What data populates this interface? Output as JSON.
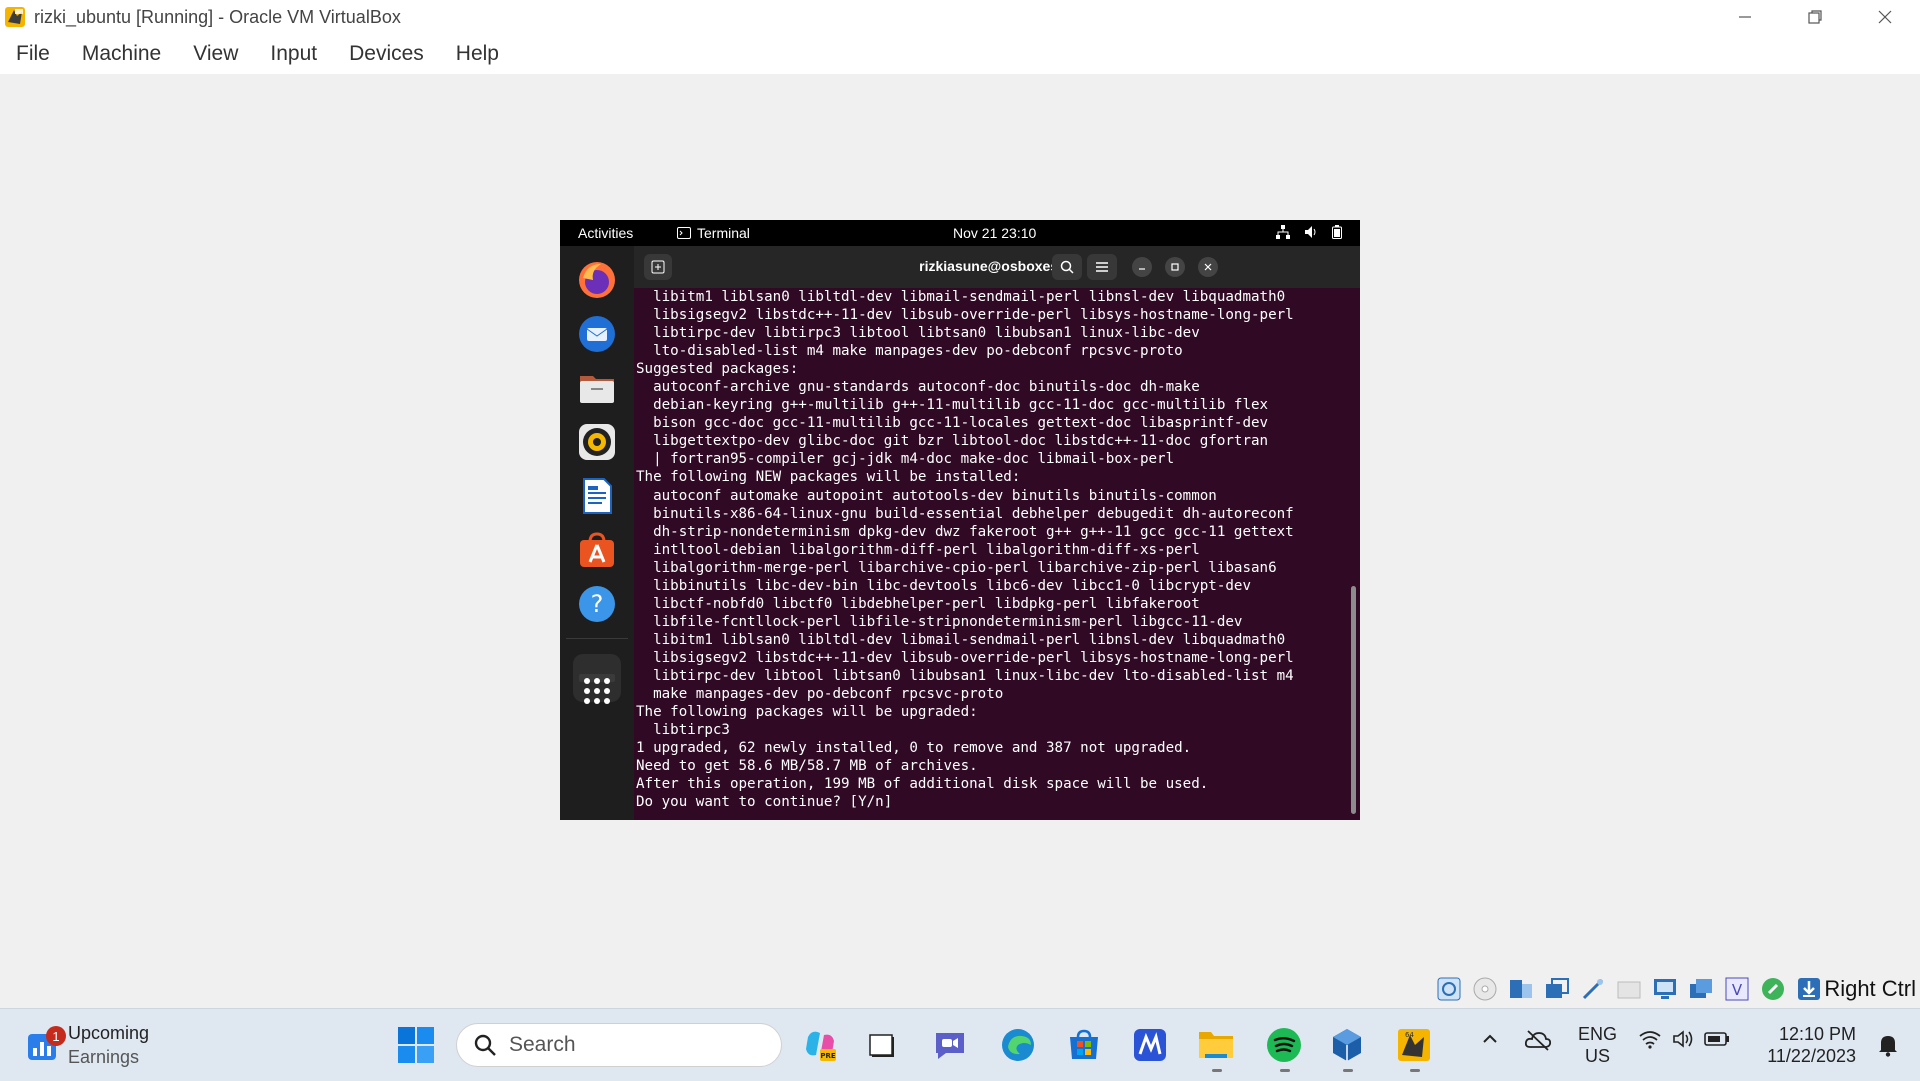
{
  "vbox": {
    "title": "rizki_ubuntu [Running] - Oracle VM VirtualBox",
    "menu": [
      "File",
      "Machine",
      "View",
      "Input",
      "Devices",
      "Help"
    ],
    "host_key": "Right Ctrl"
  },
  "gnome": {
    "activities": "Activities",
    "app_name": "Terminal",
    "clock": "Nov 21  23:10"
  },
  "terminal": {
    "title": "rizkiasune@osboxes: ~",
    "lines": [
      "  libitm1 liblsan0 libltdl-dev libmail-sendmail-perl libnsl-dev libquadmath0",
      "  libsigsegv2 libstdc++-11-dev libsub-override-perl libsys-hostname-long-perl",
      "  libtirpc-dev libtirpc3 libtool libtsan0 libubsan1 linux-libc-dev",
      "  lto-disabled-list m4 make manpages-dev po-debconf rpcsvc-proto",
      "Suggested packages:",
      "  autoconf-archive gnu-standards autoconf-doc binutils-doc dh-make",
      "  debian-keyring g++-multilib g++-11-multilib gcc-11-doc gcc-multilib flex",
      "  bison gcc-doc gcc-11-multilib gcc-11-locales gettext-doc libasprintf-dev",
      "  libgettextpo-dev glibc-doc git bzr libtool-doc libstdc++-11-doc gfortran",
      "  | fortran95-compiler gcj-jdk m4-doc make-doc libmail-box-perl",
      "The following NEW packages will be installed:",
      "  autoconf automake autopoint autotools-dev binutils binutils-common",
      "  binutils-x86-64-linux-gnu build-essential debhelper debugedit dh-autoreconf",
      "  dh-strip-nondeterminism dpkg-dev dwz fakeroot g++ g++-11 gcc gcc-11 gettext",
      "  intltool-debian libalgorithm-diff-perl libalgorithm-diff-xs-perl",
      "  libalgorithm-merge-perl libarchive-cpio-perl libarchive-zip-perl libasan6",
      "  libbinutils libc-dev-bin libc-devtools libc6-dev libcc1-0 libcrypt-dev",
      "  libctf-nobfd0 libctf0 libdebhelper-perl libdpkg-perl libfakeroot",
      "  libfile-fcntllock-perl libfile-stripnondeterminism-perl libgcc-11-dev",
      "  libitm1 liblsan0 libltdl-dev libmail-sendmail-perl libnsl-dev libquadmath0",
      "  libsigsegv2 libstdc++-11-dev libsub-override-perl libsys-hostname-long-perl",
      "  libtirpc-dev libtool libtsan0 libubsan1 linux-libc-dev lto-disabled-list m4",
      "  make manpages-dev po-debconf rpcsvc-proto",
      "The following packages will be upgraded:",
      "  libtirpc3",
      "1 upgraded, 62 newly installed, 0 to remove and 387 not upgraded.",
      "Need to get 58.6 MB/58.7 MB of archives.",
      "After this operation, 199 MB of additional disk space will be used.",
      "Do you want to continue? [Y/n] "
    ]
  },
  "taskbar": {
    "widget_title": "Upcoming",
    "widget_sub": "Earnings",
    "widget_badge": "1",
    "search_placeholder": "Search",
    "lang_top": "ENG",
    "lang_bottom": "US",
    "time": "12:10 PM",
    "date": "11/22/2023"
  },
  "colors": {
    "terminal_bg": "#300a24",
    "dock_bg": "#1e1e1e",
    "taskbar_bg": "#dfe8f1",
    "ubuntu_orange": "#e95420"
  }
}
